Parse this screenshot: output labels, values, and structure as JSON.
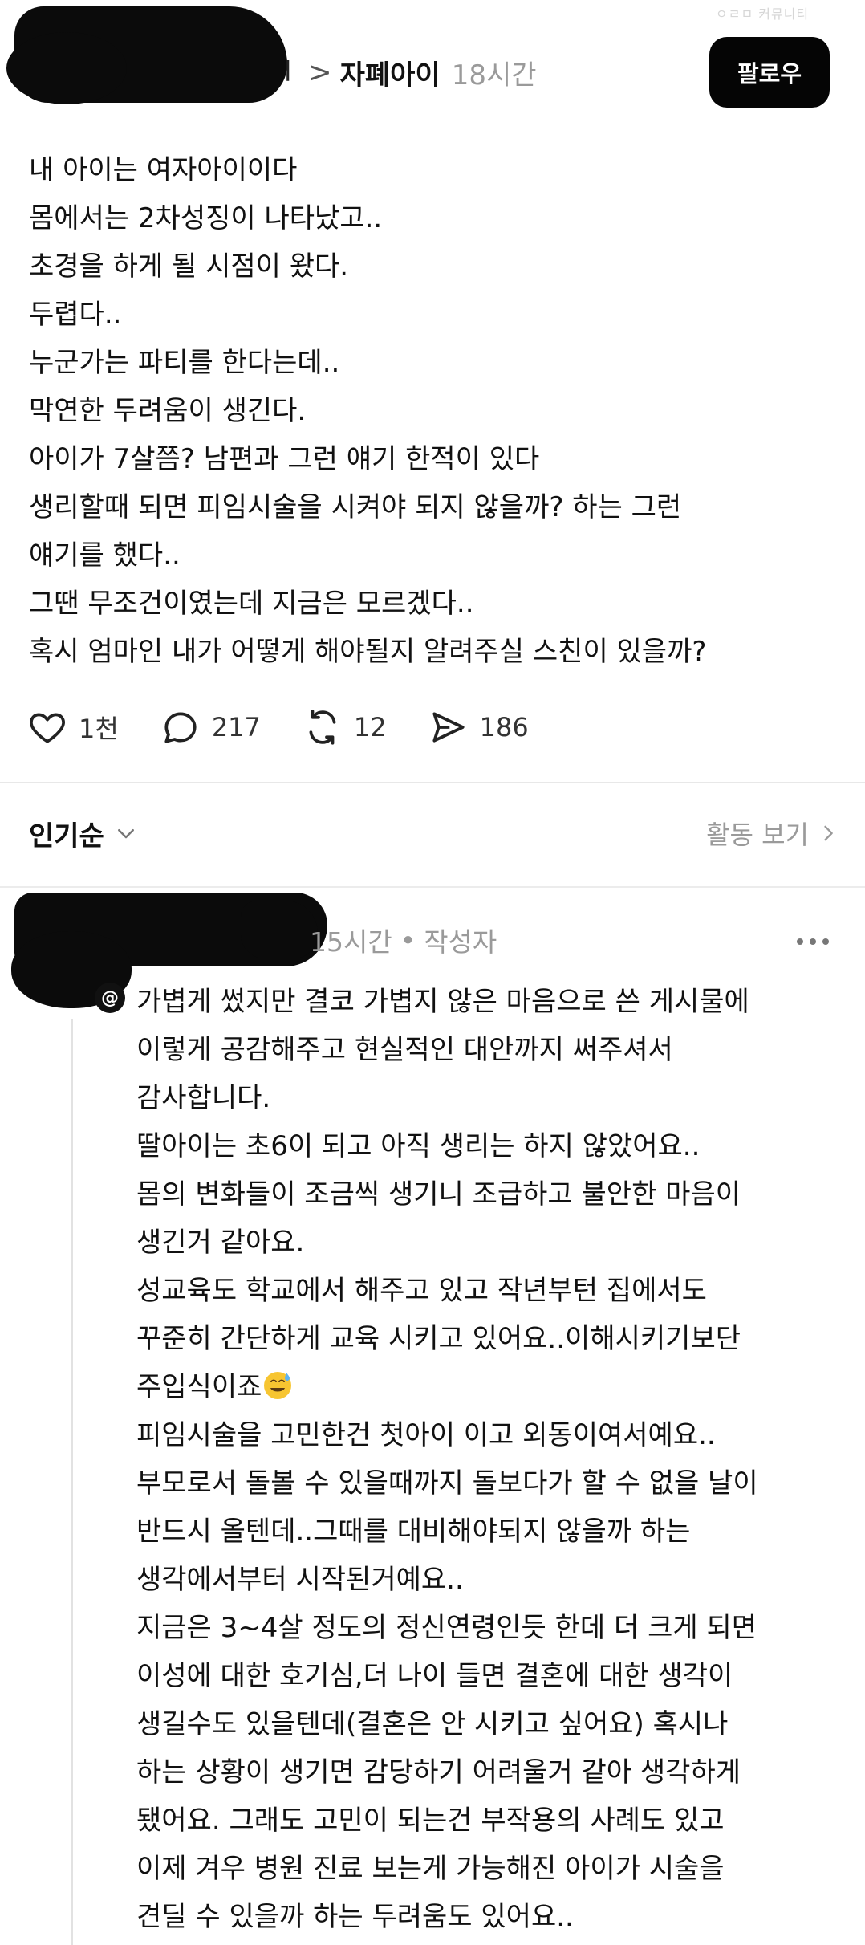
{
  "header": {
    "author_mark": "l",
    "separator": ">",
    "group": "자폐아이",
    "time": "18시간",
    "follow_label": "팔로우",
    "watermark": "ㅇㄹㅁ 커뮤니티"
  },
  "post": {
    "lines": [
      "내 아이는 여자아이이다",
      "몸에서는 2차성징이 나타났고..",
      "초경을 하게 될 시점이 왔다.",
      "두렵다..",
      "누군가는 파티를 한다는데..",
      "막연한 두려움이 생긴다.",
      "아이가 7살쯤? 남편과 그런 얘기 한적이 있다",
      "생리할때 되면 피임시술을 시켜야 되지 않을까? 하는 그런",
      "얘기를 했다..",
      "그땐 무조건이였는데 지금은 모르겠다..",
      "혹시 엄마인 내가 어떻게 해야될지 알려주실 스친이 있을까?"
    ],
    "actions": {
      "like_count": "1천",
      "comment_count": "217",
      "repost_count": "12",
      "share_count": "186"
    }
  },
  "sort": {
    "label": "인기순",
    "activity_label": "활동 보기"
  },
  "reply": {
    "time": "15시간",
    "dot": "•",
    "badge": "작성자",
    "lines": [
      "가볍게 썼지만 결코 가볍지 않은 마음으로 쓴 게시물에",
      "이렇게 공감해주고 현실적인 대안까지 써주셔서",
      "감사합니다.",
      "딸아이는 초6이 되고 아직 생리는 하지 않았어요..",
      "몸의 변화들이 조금씩 생기니 조급하고 불안한 마음이",
      "생긴거 같아요.",
      "성교육도 학교에서 해주고 있고 작년부턴 집에서도",
      "꾸준히 간단하게 교육 시키고 있어요..이해시키기보단",
      "주입식이죠",
      "피임시술을 고민한건 첫아이 이고 외동이여서예요..",
      "부모로서 돌볼 수 있을때까지 돌보다가 할 수 없을 날이",
      "반드시 올텐데..그때를 대비해야되지 않을까 하는",
      "생각에서부터 시작된거예요..",
      "지금은 3~4살 정도의 정신연령인듯 한데 더 크게 되면",
      "이성에 대한 호기심,더 나이 들면 결혼에 대한 생각이",
      "생길수도 있을텐데(결혼은 안 시키고 싶어요) 혹시나",
      "하는 상황이 생기면 감당하기 어려울거 같아 생각하게",
      "됐어요. 그래도 고민이 되는건 부작용의 사례도 있고",
      "이제 겨우 병원 진료 보는게 가능해진 아이가 시술을",
      "견딜 수 있을까 하는 두려움도 있어요.."
    ]
  }
}
